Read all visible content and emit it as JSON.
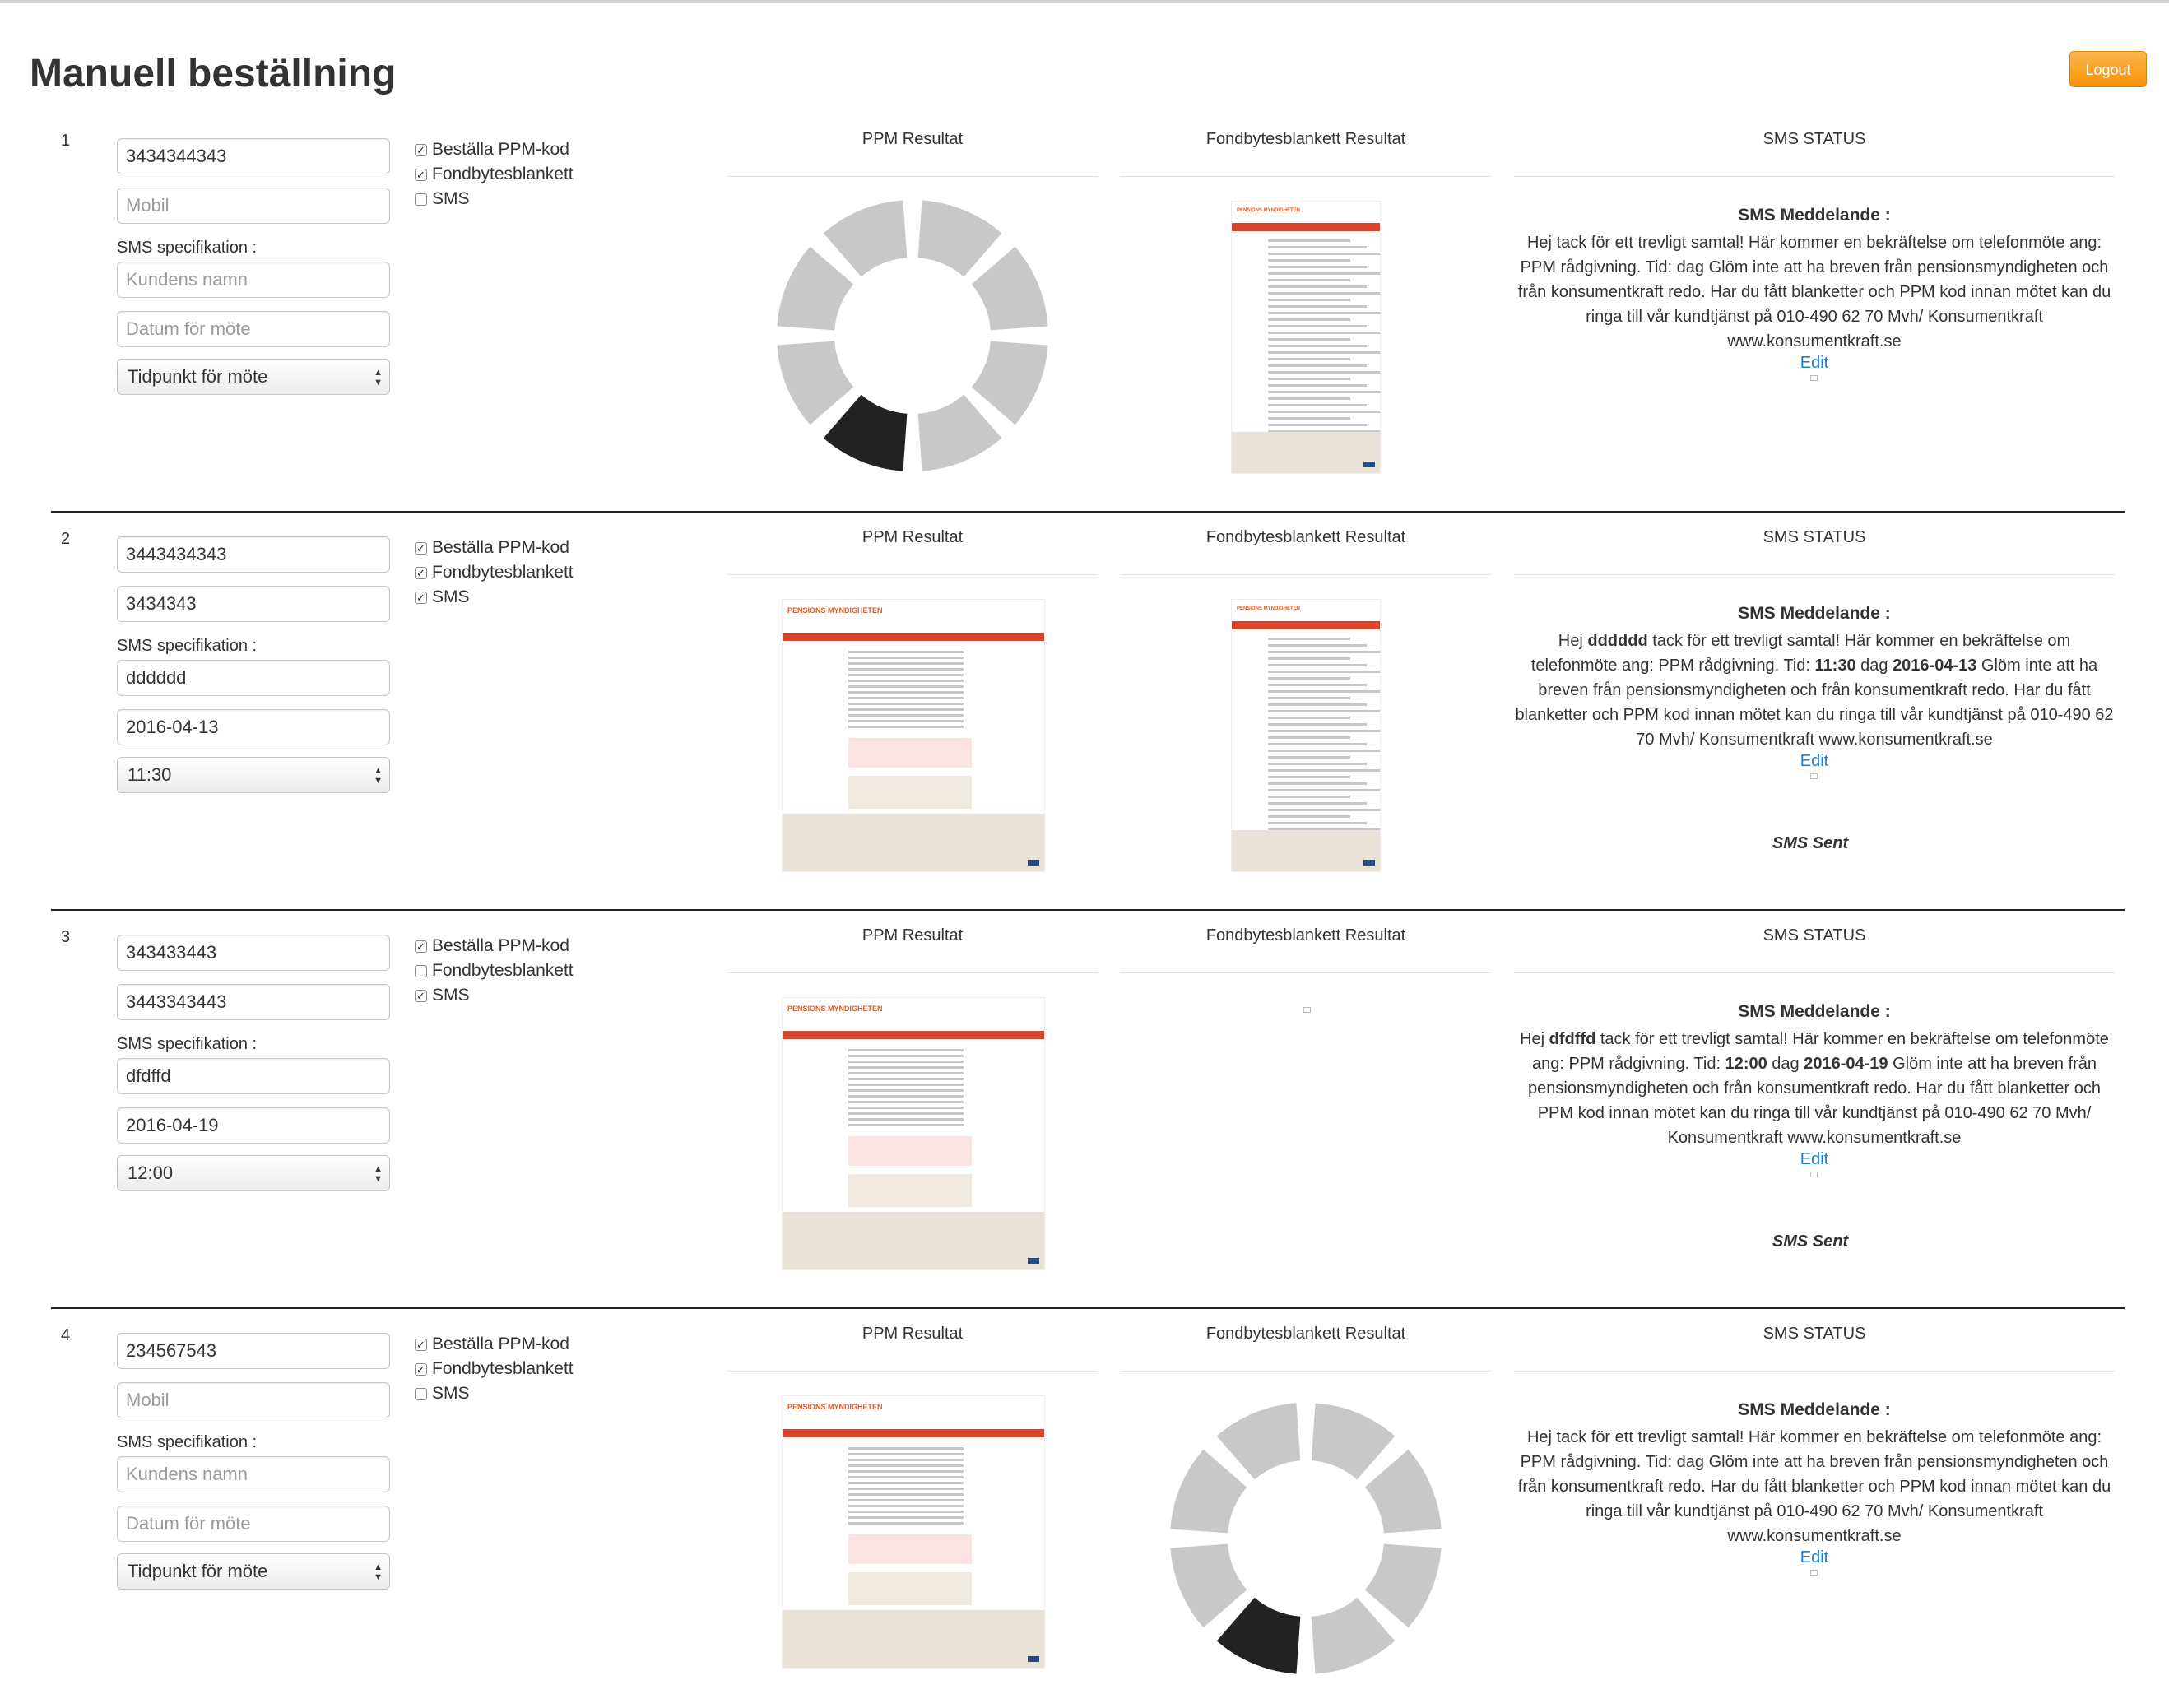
{
  "page": {
    "title": "Manuell beställning",
    "logout": "Logout"
  },
  "columns": {
    "ppm": "PPM Resultat",
    "fond": "Fondbytesblankett Resultat",
    "sms": "SMS STATUS"
  },
  "labels": {
    "sms_spec": "SMS specifikation :",
    "cb_ppm": "Beställa PPM-kod",
    "cb_fond": "Fondbytesblankett",
    "cb_sms": "SMS",
    "sms_msg_title": "SMS Meddelande :",
    "edit": "Edit",
    "sms_sent": "SMS Sent",
    "thumb_logo": "PENSIONS MYNDIGHETEN"
  },
  "orders": [
    {
      "num": "1",
      "personnummer": "3434344343",
      "mobile": "",
      "mobile_placeholder": "Mobil",
      "name": "",
      "name_placeholder": "Kundens namn",
      "date": "",
      "date_placeholder": "Datum för möte",
      "time": "Tidpunkt för möte",
      "ppm_checked": true,
      "fond_checked": true,
      "sms_checked": false,
      "ppm_result": "loading",
      "fond_result": "document",
      "sms_message": "Hej tack för ett trevligt samtal! Här kommer en bekräftelse om telefonmöte ang: PPM rådgivning. Tid: dag Glöm inte att ha breven från pensionsmyndigheten och från konsumentkraft redo. Har du fått blanketter och PPM kod innan mötet kan du ringa till vår kundtjänst på 010-490 62 70 Mvh/ Konsumentkraft www.konsumentkraft.se",
      "sms_sent": false
    },
    {
      "num": "2",
      "personnummer": "3443434343",
      "mobile": "3434343",
      "mobile_placeholder": "Mobil",
      "name": "dddddd",
      "name_placeholder": "Kundens namn",
      "date": "2016-04-13",
      "date_placeholder": "Datum för möte",
      "time": "11:30",
      "ppm_checked": true,
      "fond_checked": true,
      "sms_checked": true,
      "ppm_result": "document",
      "fond_result": "document",
      "sms_parts": [
        "Hej ",
        "dddddd",
        " tack för ett trevligt samtal! Här kommer en bekräftelse om telefonmöte ang: PPM rådgivning. Tid: ",
        "11:30",
        " dag ",
        "2016-04-13",
        " Glöm inte att ha breven från pensionsmyndigheten och från konsumentkraft redo. Har du fått blanketter och PPM kod innan mötet kan du ringa till vår kundtjänst på 010-490 62 70 Mvh/ Konsumentkraft www.konsumentkraft.se"
      ],
      "sms_sent": true
    },
    {
      "num": "3",
      "personnummer": "343433443",
      "mobile": "3443343443",
      "mobile_placeholder": "Mobil",
      "name": "dfdffd",
      "name_placeholder": "Kundens namn",
      "date": "2016-04-19",
      "date_placeholder": "Datum för möte",
      "time": "12:00",
      "ppm_checked": true,
      "fond_checked": false,
      "sms_checked": true,
      "ppm_result": "document",
      "fond_result": "none",
      "sms_parts": [
        "Hej ",
        "dfdffd",
        " tack för ett trevligt samtal! Här kommer en bekräftelse om telefonmöte ang: PPM rådgivning. Tid: ",
        "12:00",
        " dag ",
        "2016-04-19",
        " Glöm inte att ha breven från pensionsmyndigheten och från konsumentkraft redo. Har du fått blanketter och PPM kod innan mötet kan du ringa till vår kundtjänst på 010-490 62 70 Mvh/ Konsumentkraft www.konsumentkraft.se"
      ],
      "sms_sent": true
    },
    {
      "num": "4",
      "personnummer": "234567543",
      "mobile": "",
      "mobile_placeholder": "Mobil",
      "name": "",
      "name_placeholder": "Kundens namn",
      "date": "",
      "date_placeholder": "Datum för möte",
      "time": "Tidpunkt för möte",
      "ppm_checked": true,
      "fond_checked": true,
      "sms_checked": false,
      "ppm_result": "document",
      "fond_result": "loading",
      "sms_message": "Hej tack för ett trevligt samtal! Här kommer en bekräftelse om telefonmöte ang: PPM rådgivning. Tid: dag Glöm inte att ha breven från pensionsmyndigheten och från konsumentkraft redo. Har du fått blanketter och PPM kod innan mötet kan du ringa till vår kundtjänst på 010-490 62 70 Mvh/ Konsumentkraft www.konsumentkraft.se",
      "sms_sent": false
    }
  ],
  "colors": {
    "logout": "#f89406",
    "link": "#1a7fd4",
    "separator": "#222222",
    "thumb_nav": "#d9442a"
  }
}
